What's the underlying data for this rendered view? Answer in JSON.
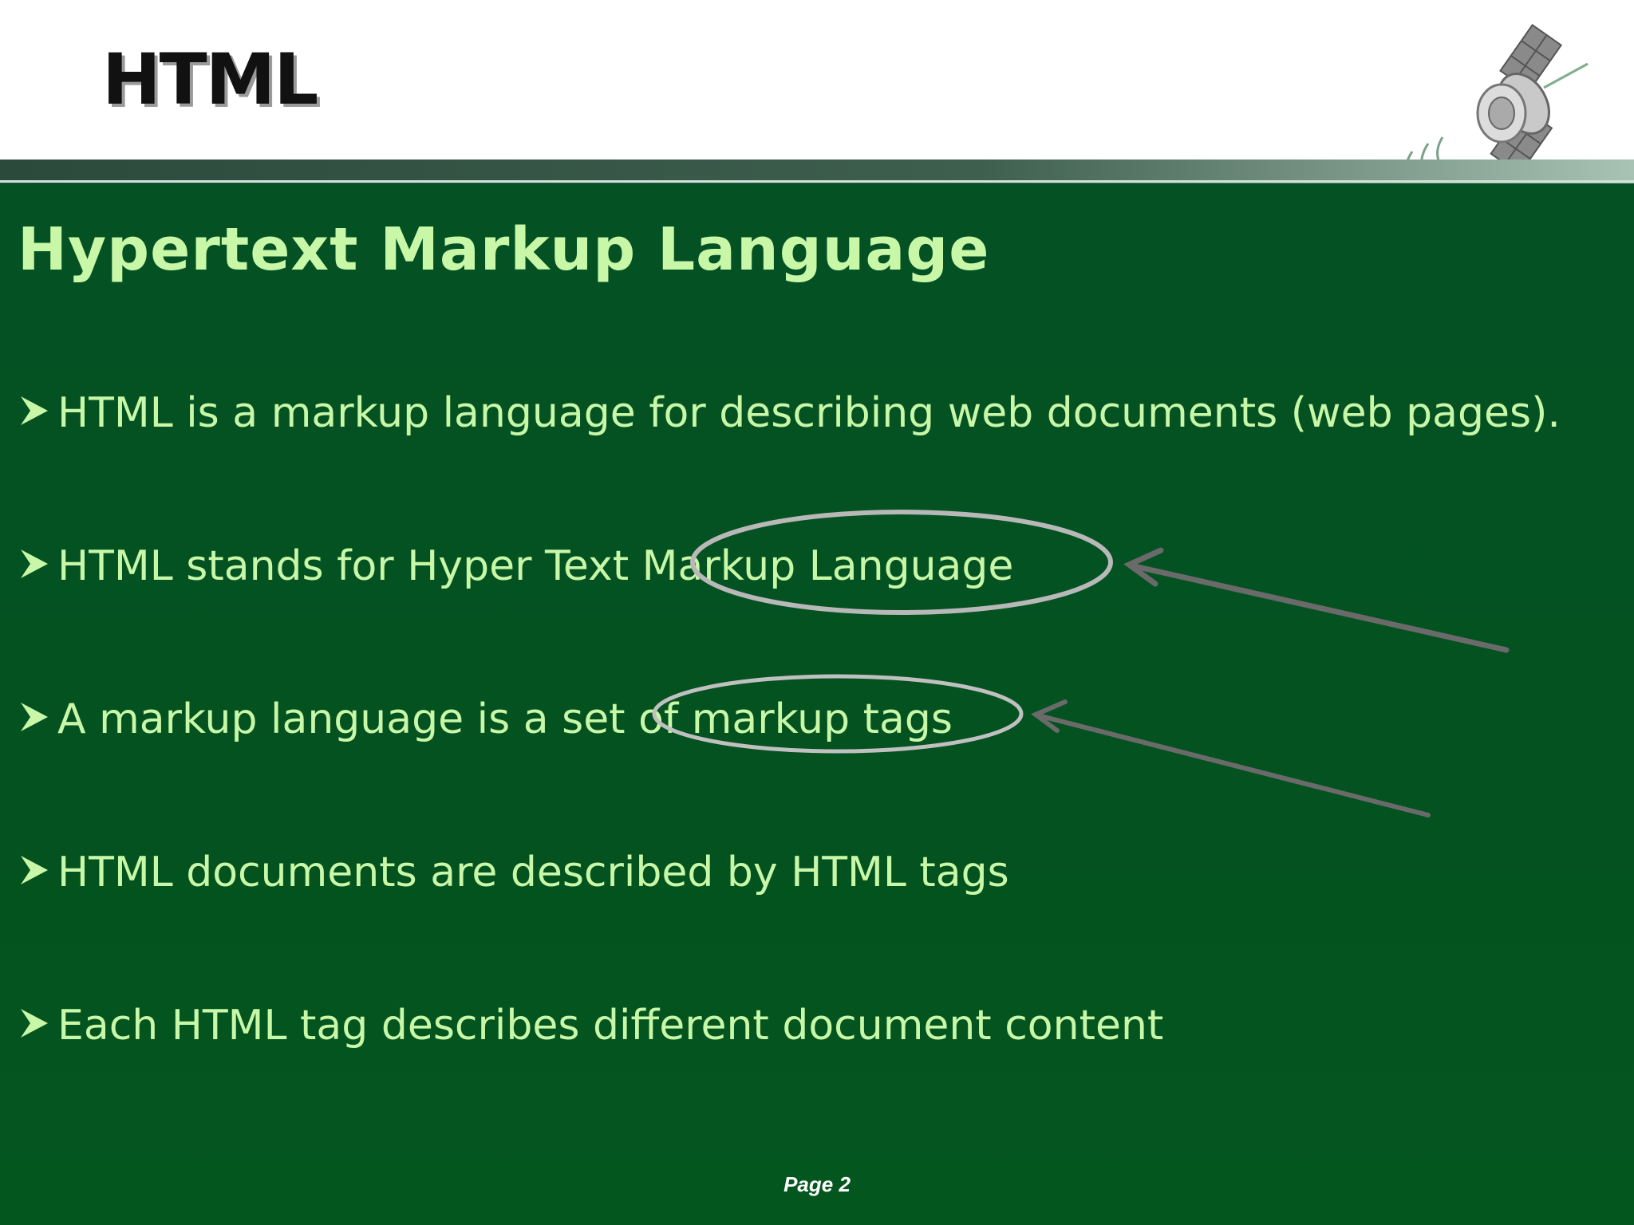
{
  "header": {
    "title": "HTML"
  },
  "slide": {
    "subtitle": "Hypertext Markup Language",
    "bullets": [
      "HTML is a markup language for describing web documents (web pages).",
      "HTML stands for Hyper Text Markup Language",
      "A markup language is a set of markup tags",
      "HTML documents are described by HTML tags",
      "Each HTML tag describes different document content"
    ]
  },
  "footer": {
    "page_label": "Page  2"
  },
  "colors": {
    "background": "#045224",
    "text": "#c8f7a8",
    "title": "#111111"
  },
  "icons": {
    "bullet": "arrowhead-bullet-icon",
    "logo": "satellite-icon"
  }
}
